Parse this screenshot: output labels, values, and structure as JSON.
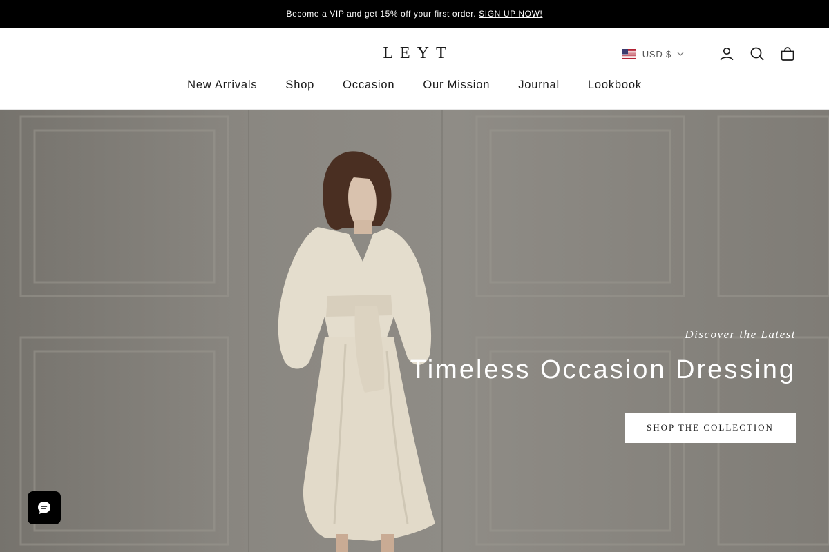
{
  "announcement": {
    "text": "Become a VIP and get 15% off your first order.",
    "link_label": "SIGN UP NOW!"
  },
  "header": {
    "logo": "LEYT",
    "currency": {
      "label": "USD $",
      "flag_icon": "us-flag-icon"
    },
    "icons": [
      "account-icon",
      "search-icon",
      "bag-icon"
    ]
  },
  "nav": {
    "items": [
      {
        "label": "New Arrivals"
      },
      {
        "label": "Shop"
      },
      {
        "label": "Occasion"
      },
      {
        "label": "Our Mission"
      },
      {
        "label": "Journal"
      },
      {
        "label": "Lookbook"
      }
    ]
  },
  "hero": {
    "eyebrow": "Discover the Latest",
    "title": "Timeless Occasion Dressing",
    "cta_label": "SHOP THE COLLECTION"
  },
  "chat_widget": {
    "icon": "chat-icon",
    "color": "#000000"
  },
  "colors": {
    "announcement_bg": "#000000",
    "text": "#1a1a1a",
    "hero_text": "#ffffff"
  }
}
